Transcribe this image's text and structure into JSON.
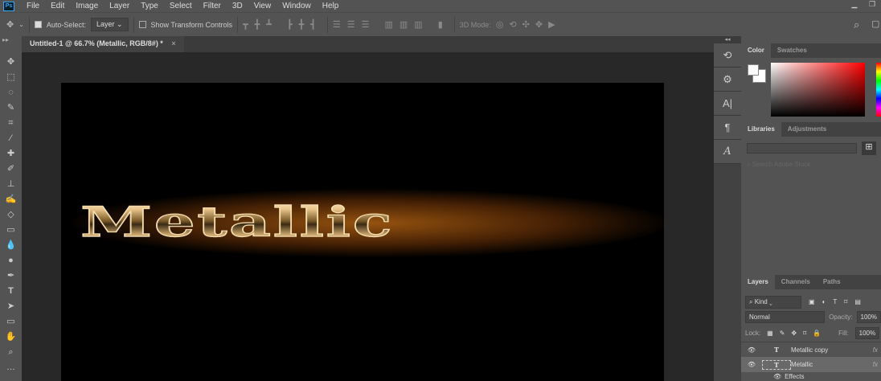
{
  "app": {
    "logo": "Ps"
  },
  "menu": [
    "File",
    "Edit",
    "Image",
    "Layer",
    "Type",
    "Select",
    "Filter",
    "3D",
    "View",
    "Window",
    "Help"
  ],
  "window_controls": [
    "minimize-icon",
    "restore-icon"
  ],
  "options": {
    "auto_select_label": "Auto-Select:",
    "auto_select_checked": true,
    "auto_select_target": "Layer",
    "show_transform_label": "Show Transform Controls",
    "show_transform_checked": false,
    "mode_3d_label": "3D Mode:"
  },
  "document": {
    "tab_title": "Untitled-1 @ 66.7% (Metallic, RGB/8#) *",
    "close": "×",
    "canvas_text": "Metallic"
  },
  "tools": [
    "move",
    "marquee",
    "lasso",
    "quick-select",
    "crop",
    "eyedropper",
    "healing",
    "brush",
    "stamp",
    "history-brush",
    "eraser",
    "gradient",
    "blur",
    "dodge",
    "pen",
    "type",
    "path-select",
    "rectangle",
    "hand",
    "zoom",
    "more"
  ],
  "color_panel": {
    "tabs": [
      "Color",
      "Swatches"
    ],
    "active": "Color",
    "foreground": "#ffffff",
    "background": "#ffffff"
  },
  "libraries_panel": {
    "tabs": [
      "Libraries",
      "Adjustments"
    ],
    "active": "Libraries",
    "search_placeholder": "Search Adobe Stock"
  },
  "layers_panel": {
    "tabs": [
      "Layers",
      "Channels",
      "Paths"
    ],
    "active": "Layers",
    "filter": "Kind",
    "blend_mode": "Normal",
    "opacity_label": "Opacity:",
    "opacity": "100%",
    "lock_label": "Lock:",
    "fill_label": "Fill:",
    "fill": "100%",
    "layers": [
      {
        "name": "Metallic copy",
        "type": "T",
        "fx": "fx",
        "selected": false
      },
      {
        "name": "Metallic",
        "type": "T",
        "fx": "fx",
        "selected": true
      }
    ],
    "effects_label": "Effects"
  }
}
